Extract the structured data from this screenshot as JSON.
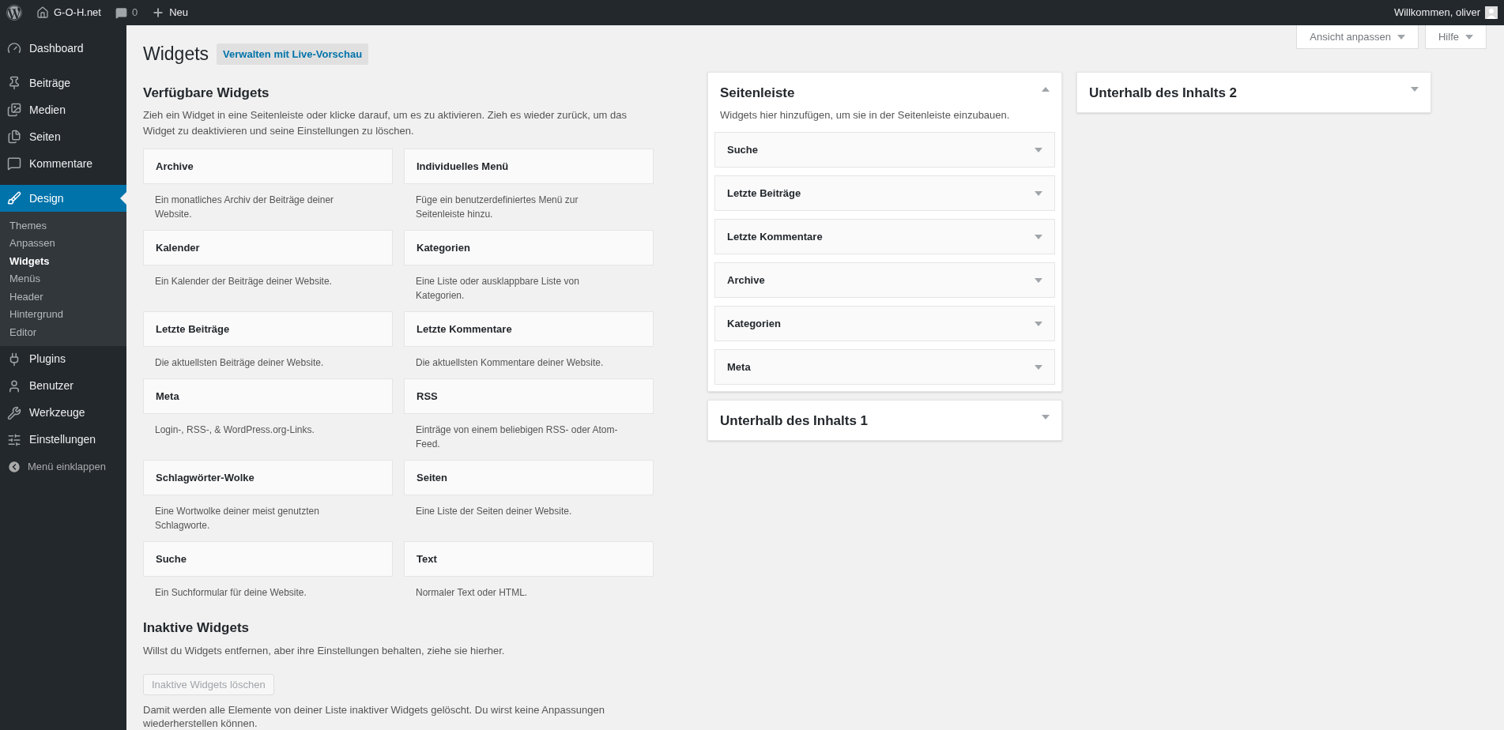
{
  "topbar": {
    "site_name": "G-O-H.net",
    "comments_count": "0",
    "new_label": "Neu",
    "greeting": "Willkommen, oliver"
  },
  "menu": [
    {
      "kind": "item",
      "label": "Dashboard",
      "selected": false
    },
    {
      "kind": "separator"
    },
    {
      "kind": "item",
      "label": "Beiträge",
      "selected": false
    },
    {
      "kind": "item",
      "label": "Medien",
      "selected": false
    },
    {
      "kind": "item",
      "label": "Seiten",
      "selected": false
    },
    {
      "kind": "item",
      "label": "Kommentare",
      "selected": false
    },
    {
      "kind": "separator"
    },
    {
      "kind": "item",
      "label": "Design",
      "selected": true,
      "children": [
        {
          "label": "Themes",
          "selected": false
        },
        {
          "label": "Anpassen",
          "selected": false
        },
        {
          "label": "Widgets",
          "selected": true
        },
        {
          "label": "Menüs",
          "selected": false
        },
        {
          "label": "Header",
          "selected": false
        },
        {
          "label": "Hintergrund",
          "selected": false
        },
        {
          "label": "Editor",
          "selected": false
        }
      ]
    },
    {
      "kind": "item",
      "label": "Plugins",
      "selected": false
    },
    {
      "kind": "item",
      "label": "Benutzer",
      "selected": false
    },
    {
      "kind": "item",
      "label": "Werkzeuge",
      "selected": false
    },
    {
      "kind": "item",
      "label": "Einstellungen",
      "selected": false
    },
    {
      "kind": "collapse",
      "label": "Menü einklappen"
    }
  ],
  "screen_tabs": [
    "Ansicht anpassen",
    "Hilfe"
  ],
  "page": {
    "title": "Widgets",
    "action": "Verwalten mit Live-Vorschau"
  },
  "available": {
    "heading": "Verfügbare Widgets",
    "description": "Zieh ein Widget in eine Seitenleiste oder klicke darauf, um es zu aktivieren. Zieh es wieder zurück, um das Widget zu deaktivieren und seine Einstellungen zu löschen.",
    "widgets": [
      {
        "title": "Archive",
        "description": "Ein monatliches Archiv der Beiträge deiner Website."
      },
      {
        "title": "Individuelles Menü",
        "description": "Füge ein benutzerdefiniertes Menü zur Seitenleiste hinzu."
      },
      {
        "title": "Kalender",
        "description": "Ein Kalender der Beiträge deiner Website."
      },
      {
        "title": "Kategorien",
        "description": "Eine Liste oder ausklappbare Liste von Kategorien."
      },
      {
        "title": "Letzte Beiträge",
        "description": "Die aktuellsten Beiträge deiner Website."
      },
      {
        "title": "Letzte Kommentare",
        "description": "Die aktuellsten Kommentare deiner Website."
      },
      {
        "title": "Meta",
        "description": "Login-, RSS-, & WordPress.org-Links."
      },
      {
        "title": "RSS",
        "description": "Einträge von einem beliebigen RSS- oder Atom-Feed."
      },
      {
        "title": "Schlagwörter-Wolke",
        "description": "Eine Wortwolke deiner meist genutzten Schlagworte."
      },
      {
        "title": "Seiten",
        "description": "Eine Liste der Seiten deiner Website."
      },
      {
        "title": "Suche",
        "description": "Ein Suchformular für deine Website."
      },
      {
        "title": "Text",
        "description": "Normaler Text oder HTML."
      }
    ]
  },
  "inactive": {
    "heading": "Inaktive Widgets",
    "description": "Willst du Widgets entfernen, aber ihre Einstellungen behalten, ziehe sie hierher.",
    "button": {
      "label": "Inaktive Widgets löschen",
      "disabled": true
    },
    "note": "Damit werden alle Elemente von deiner Liste inaktiver Widgets gelöscht. Du wirst keine Anpassungen wiederherstellen können."
  },
  "area_columns": [
    {
      "areas": [
        {
          "title": "Seitenleiste",
          "expanded": true,
          "description": "Widgets hier hinzufügen, um sie in der Seitenleiste einzubauen.",
          "widgets": [
            "Suche",
            "Letzte Beiträge",
            "Letzte Kommentare",
            "Archive",
            "Kategorien",
            "Meta"
          ]
        },
        {
          "title": "Unterhalb des Inhalts 1",
          "expanded": false
        }
      ]
    },
    {
      "areas": [
        {
          "title": "Unterhalb des Inhalts 2",
          "expanded": false
        }
      ]
    }
  ]
}
